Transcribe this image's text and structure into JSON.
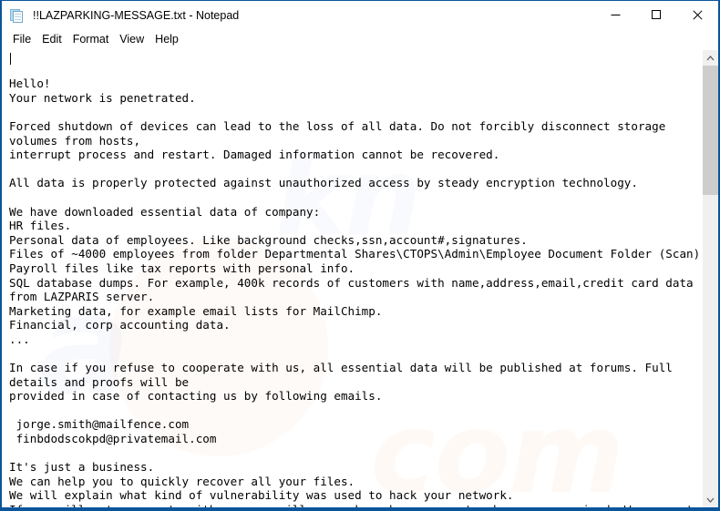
{
  "window": {
    "title": "!!LAZPARKING-MESSAGE.txt - Notepad",
    "app_icon": "notepad-icon",
    "accent_color": "#0a559b",
    "background_color": "#ffffff",
    "text_color": "#000000"
  },
  "titlebar": {
    "minimize_label": "minimize-icon",
    "maximize_label": "maximize-icon",
    "close_label": "close-icon"
  },
  "menubar": {
    "items": [
      {
        "label": "File"
      },
      {
        "label": "Edit"
      },
      {
        "label": "Format"
      },
      {
        "label": "View"
      },
      {
        "label": "Help"
      }
    ]
  },
  "editor": {
    "content": "\nHello!\nYour network is penetrated.\n\nForced shutdown of devices can lead to the loss of all data. Do not forcibly disconnect storage\nvolumes from hosts,\ninterrupt process and restart. Damaged information cannot be recovered.\n\nAll data is properly protected against unauthorized access by steady encryption technology.\n\nWe have downloaded essential data of company:\nHR files.\nPersonal data of employees. Like background checks,ssn,account#,signatures.\nFiles of ~4000 employees from folder Departmental Shares\\CTOPS\\Admin\\Employee Document Folder (Scan)\nPayroll files like tax reports with personal info.\nSQL database dumps. For example, 400k records of customers with name,address,email,credit card data\nfrom LAZPARIS server.\nMarketing data, for example email lists for MailChimp.\nFinancial, corp accounting data.\n...\n\nIn case if you refuse to cooperate with us, all essential data will be published at forums. Full\ndetails and proofs will be\nprovided in case of contacting us by following emails.\n\n jorge.smith@mailfence.com\n finbdodscokpd@privatemail.com\n\nIt's just a business.\nWe can help you to quickly recover all your files.\nWe will explain what kind of vulnerability was used to hack your network.\nIf you will not cooperate with us, you will never know how your network was compromised. We guarantee",
    "emails": [
      "jorge.smith@mailfence.com",
      "finbdodscokpd@privatemail.com"
    ],
    "ransom_note_name": "!!LAZPARKING-MESSAGE.txt",
    "compromised_server": "LAZPARIS",
    "employee_count": "~4000",
    "customer_records": "400k",
    "data_path": "Departmental Shares\\CTOPS\\Admin\\Employee Document Folder (Scan)"
  },
  "scrollbar": {
    "up_arrow": "chevron-up-icon",
    "down_arrow": "chevron-down-icon",
    "thumb_color": "#cdcdcd",
    "track_color": "#f0f0f0"
  },
  "watermark": {
    "line_1": "com",
    "line_2": "kn",
    "line_3": "a"
  }
}
